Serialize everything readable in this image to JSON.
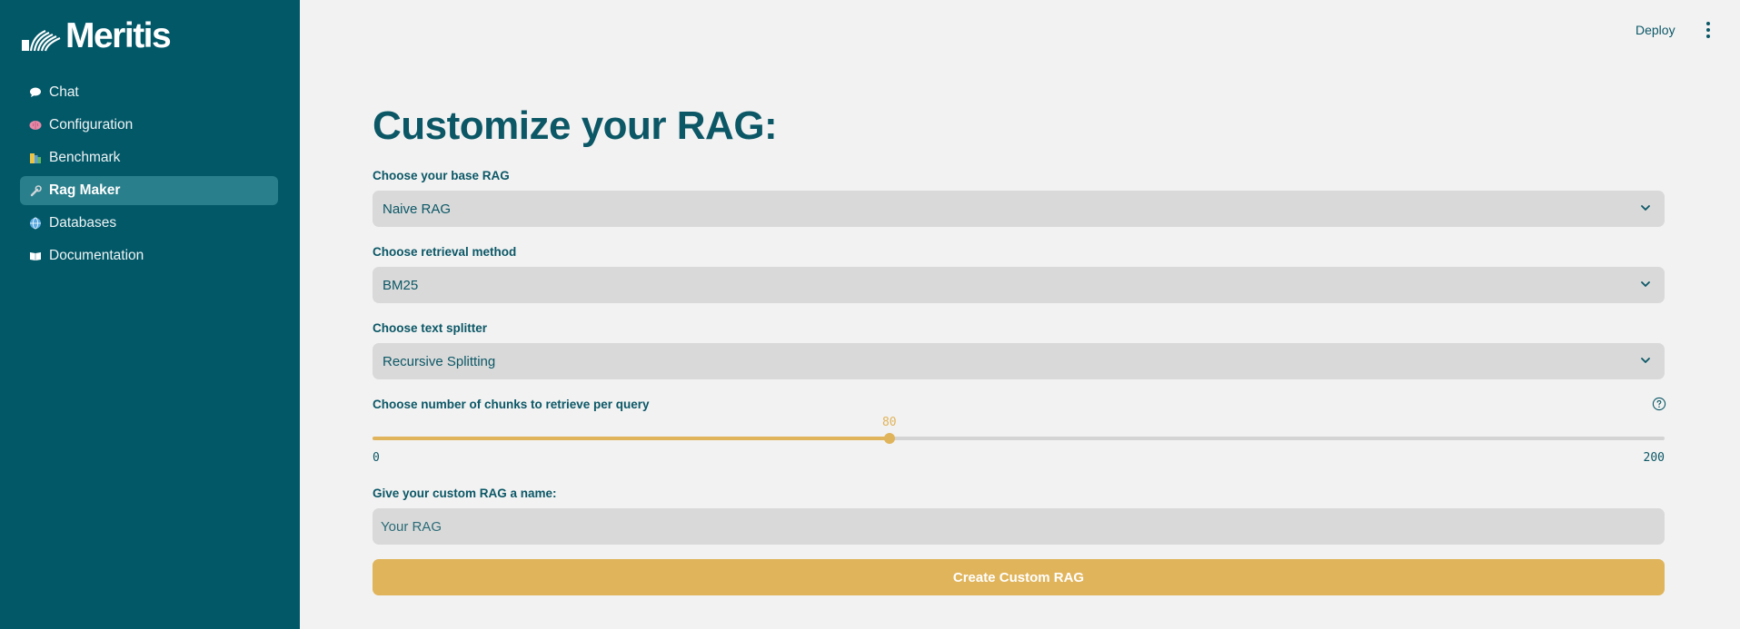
{
  "brand": {
    "name": "Meritis"
  },
  "header": {
    "deploy_label": "Deploy",
    "menu_icon": "kebab-menu-icon"
  },
  "sidebar": {
    "items": [
      {
        "label": "Chat",
        "icon": "speech-bubble-icon",
        "active": false
      },
      {
        "label": "Configuration",
        "icon": "brain-icon",
        "active": false
      },
      {
        "label": "Benchmark",
        "icon": "books-icon",
        "active": false
      },
      {
        "label": "Rag Maker",
        "icon": "wrench-icon",
        "active": true
      },
      {
        "label": "Databases",
        "icon": "globe-icon",
        "active": false
      },
      {
        "label": "Documentation",
        "icon": "open-book-icon",
        "active": false
      }
    ]
  },
  "main": {
    "title": "Customize your RAG:",
    "base_rag": {
      "label": "Choose your base RAG",
      "value": "Naive RAG"
    },
    "retrieval": {
      "label": "Choose retrieval method",
      "value": "BM25"
    },
    "splitter": {
      "label": "Choose text splitter",
      "value": "Recursive Splitting"
    },
    "chunks": {
      "label": "Choose number of chunks to retrieve per query",
      "value": "80",
      "min": "0",
      "max": "200"
    },
    "name_field": {
      "label": "Give your custom RAG a name:",
      "placeholder": "Your RAG"
    },
    "create_button": "Create Custom RAG"
  },
  "colors": {
    "sidebar": "#035868",
    "active_item": "#2a7f8c",
    "accent": "#e0b45a",
    "text": "#0b5766",
    "background": "#f2f2f2",
    "field": "#d9d9d9"
  }
}
